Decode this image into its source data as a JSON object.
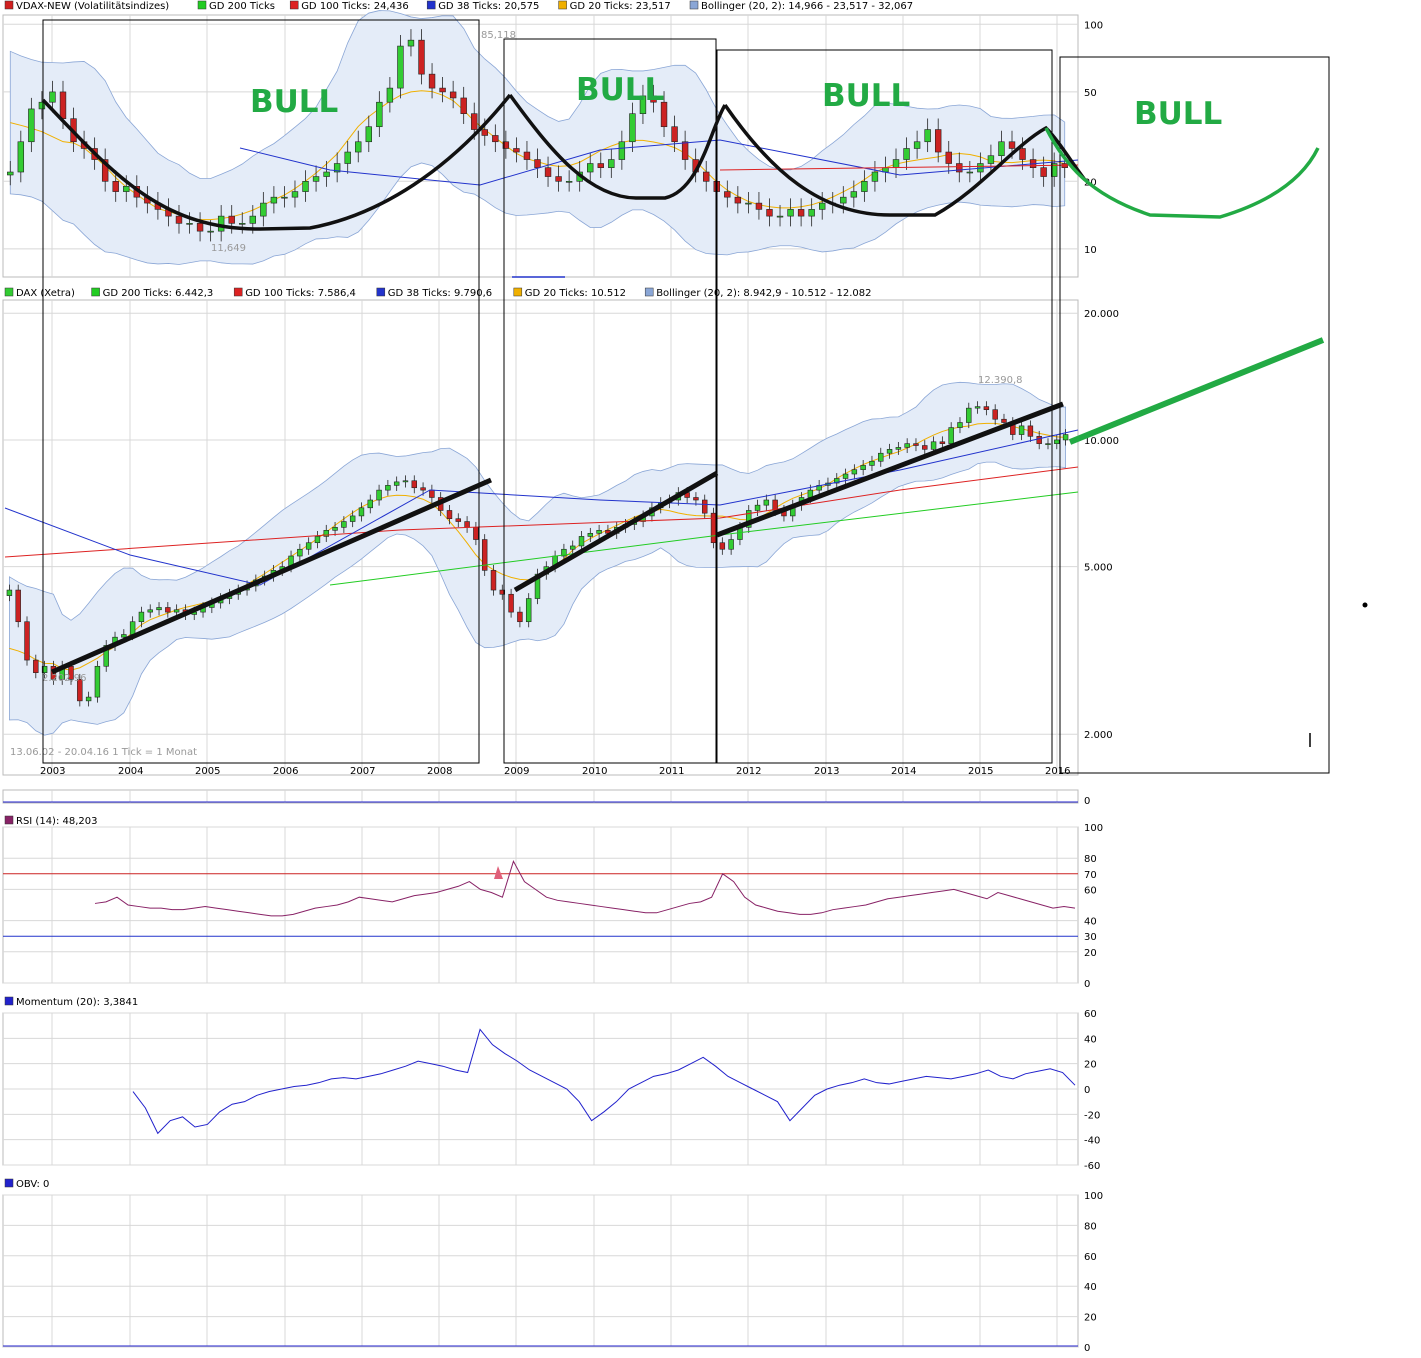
{
  "colors": {
    "bull": "#22aa44",
    "up": "#33cc33",
    "down": "#cc2222",
    "bb_fill": "#e4ecf8",
    "bb_line": "#8aa6d6",
    "ma200": "#22cc22",
    "ma100": "#dd2222",
    "ma38": "#2233cc",
    "ma20": "#f0b000",
    "grid": "#d8d8d8",
    "rsi": "#882266",
    "mom": "#2222cc",
    "annot": "#000000"
  },
  "vdax": {
    "legend": [
      {
        "label": "VDAX-NEW (Volatilitätsindizes)",
        "color": "#d02020"
      },
      {
        "label": "GD 200 Ticks",
        "color": "#22cc22"
      },
      {
        "label": "GD 100 Ticks: 24,436",
        "color": "#dd2222"
      },
      {
        "label": "GD 38 Ticks: 20,575",
        "color": "#2233cc"
      },
      {
        "label": "GD 20 Ticks: 23,517",
        "color": "#f0b000"
      },
      {
        "label": "Bollinger (20, 2): 14,966 - 23,517 - 32,067",
        "color": "#8aa6d6"
      }
    ],
    "yticks": [
      {
        "v": 100,
        "l": "100"
      },
      {
        "v": 50,
        "l": "50"
      },
      {
        "v": 20,
        "l": "20"
      },
      {
        "v": 10,
        "l": "10"
      }
    ],
    "high_label": "85,118",
    "low_label": "11,649"
  },
  "dax": {
    "legend": [
      {
        "label": "DAX (Xetra)",
        "color": "#33cc33"
      },
      {
        "label": "GD 200 Ticks: 6.442,3",
        "color": "#22cc22"
      },
      {
        "label": "GD 100 Ticks: 7.586,4",
        "color": "#dd2222"
      },
      {
        "label": "GD 38 Ticks: 9.790,6",
        "color": "#2233cc"
      },
      {
        "label": "GD 20 Ticks: 10.512",
        "color": "#f0b000"
      },
      {
        "label": "Bollinger (20, 2): 8.942,9 - 10.512 - 12.082",
        "color": "#8aa6d6"
      }
    ],
    "yticks": [
      {
        "v": 20000,
        "l": "20.000"
      },
      {
        "v": 10000,
        "l": "10.000"
      },
      {
        "v": 5000,
        "l": "5.000"
      },
      {
        "v": 2000,
        "l": "2.000"
      }
    ],
    "high_label": "12.390,8",
    "low_label": "2.202,96",
    "range_label": "13.06.02 - 20.04.16   1 Tick = 1 Monat"
  },
  "xaxis": {
    "labels": [
      "2003",
      "2004",
      "2005",
      "2006",
      "2007",
      "2008",
      "2009",
      "2010",
      "2011",
      "2012",
      "2013",
      "2014",
      "2015",
      "2016"
    ]
  },
  "volume_panel": {
    "ytick": "0"
  },
  "rsi": {
    "legend": "RSI (14): 48,203",
    "yticks": [
      "100",
      "80",
      "60",
      "40",
      "20",
      "0"
    ],
    "ref_levels": [
      {
        "v": 70,
        "l": "70",
        "color": "#cc2222"
      },
      {
        "v": 30,
        "l": "30",
        "color": "#2233cc"
      }
    ]
  },
  "momentum": {
    "legend": "Momentum (20): 3,3841",
    "yticks": [
      "60",
      "40",
      "20",
      "0",
      "-20",
      "-40",
      "-60"
    ]
  },
  "obv": {
    "legend": "OBV: 0",
    "yticks": [
      "100",
      "80",
      "60",
      "40",
      "20",
      "0"
    ]
  },
  "annotations": {
    "bull_label": "BULL"
  },
  "chart_data": [
    {
      "type": "candlestick",
      "title": "VDAX-NEW (Volatilitätsindizes)",
      "x_period": "monthly, 2002-06 to 2016-04",
      "y_scale": "log",
      "ylim": [
        7,
        120
      ],
      "close_series": [
        22,
        30,
        42,
        45,
        50,
        38,
        30,
        28,
        25,
        20,
        18,
        19,
        17,
        16,
        15,
        14,
        13,
        13,
        12,
        12,
        14,
        13,
        13,
        14,
        16,
        17,
        17,
        18,
        20,
        21,
        22,
        24,
        27,
        30,
        35,
        45,
        52,
        80,
        85,
        60,
        52,
        50,
        47,
        40,
        34,
        32,
        30,
        28,
        27,
        25,
        23,
        21,
        20,
        20,
        22,
        24,
        23,
        25,
        30,
        40,
        48,
        45,
        35,
        30,
        25,
        22,
        20,
        18,
        17,
        16,
        16,
        15,
        14,
        14,
        15,
        14,
        15,
        16,
        16,
        17,
        18,
        20,
        22,
        23,
        25,
        28,
        30,
        34,
        27,
        24,
        22,
        22,
        24,
        26,
        30,
        28,
        25,
        23,
        21,
        24,
        23
      ],
      "notes": "Candles read approximately; first candle ~2002-06; high 85,118 (2008-10); low 11,649 (2005/06)."
    },
    {
      "type": "candlestick",
      "title": "DAX (Xetra)",
      "x_period": "monthly, 2002-06 to 2016-04",
      "y_scale": "log",
      "ylim": [
        1500,
        22000
      ],
      "close_series": [
        4400,
        3700,
        3000,
        2800,
        2900,
        2700,
        2900,
        2700,
        2400,
        2450,
        2900,
        3250,
        3400,
        3450,
        3700,
        3900,
        3950,
        4000,
        3900,
        3950,
        3850,
        3900,
        4000,
        4100,
        4200,
        4300,
        4400,
        4500,
        4650,
        4750,
        4900,
        5000,
        5300,
        5500,
        5700,
        5900,
        6100,
        6200,
        6400,
        6600,
        6900,
        7200,
        7600,
        7800,
        7950,
        8000,
        7700,
        7600,
        7300,
        6800,
        6500,
        6400,
        6200,
        5800,
        4900,
        4400,
        4300,
        3900,
        3700,
        4200,
        4800,
        5000,
        5300,
        5500,
        5600,
        5900,
        6000,
        6100,
        6000,
        6200,
        6300,
        6400,
        6600,
        6900,
        7100,
        7200,
        7500,
        7300,
        7200,
        6700,
        5700,
        5500,
        5800,
        6200,
        6800,
        7000,
        7200,
        6800,
        6600,
        7000,
        7300,
        7600,
        7800,
        7900,
        8100,
        8300,
        8500,
        8700,
        8900,
        9300,
        9500,
        9600,
        9800,
        9700,
        9500,
        9900,
        9800,
        10700,
        11000,
        11900,
        12000,
        11800,
        11200,
        11000,
        10300,
        10800,
        10200,
        9800,
        9800,
        10000,
        10300
      ],
      "notes": "High 12.390,8 (2015-04); low 2.202,96 (2003-03)."
    },
    {
      "type": "line",
      "title": "RSI (14): 48,203",
      "ylim": [
        0,
        100
      ],
      "levels": [
        70,
        30
      ],
      "values": [
        51,
        52,
        55,
        50,
        49,
        48,
        48,
        47,
        47,
        48,
        49,
        48,
        47,
        46,
        45,
        44,
        43,
        43,
        44,
        46,
        48,
        49,
        50,
        52,
        55,
        54,
        53,
        52,
        54,
        56,
        57,
        58,
        60,
        62,
        65,
        60,
        58,
        55,
        78,
        65,
        60,
        55,
        53,
        52,
        51,
        50,
        49,
        48,
        47,
        46,
        45,
        45,
        47,
        49,
        51,
        52,
        55,
        70,
        65,
        55,
        50,
        48,
        46,
        45,
        44,
        44,
        45,
        47,
        48,
        49,
        50,
        52,
        54,
        55,
        56,
        57,
        58,
        59,
        60,
        58,
        56,
        54,
        58,
        56,
        54,
        52,
        50,
        48,
        49,
        48
      ]
    },
    {
      "type": "line",
      "title": "Momentum (20): 3,3841",
      "ylim": [
        -60,
        60
      ],
      "values": [
        -2,
        -15,
        -35,
        -25,
        -22,
        -30,
        -28,
        -18,
        -12,
        -10,
        -5,
        -2,
        0,
        2,
        3,
        5,
        8,
        9,
        8,
        10,
        12,
        15,
        18,
        22,
        20,
        18,
        15,
        13,
        47,
        35,
        28,
        22,
        15,
        10,
        5,
        0,
        -10,
        -25,
        -18,
        -10,
        0,
        5,
        10,
        12,
        15,
        20,
        25,
        18,
        10,
        5,
        0,
        -5,
        -10,
        -25,
        -15,
        -5,
        0,
        3,
        5,
        8,
        5,
        4,
        6,
        8,
        10,
        9,
        8,
        10,
        12,
        15,
        10,
        8,
        12,
        14,
        16,
        13,
        3
      ]
    },
    {
      "type": "line",
      "title": "OBV: 0",
      "ylim": [
        0,
        100
      ],
      "values": [
        0
      ]
    }
  ]
}
